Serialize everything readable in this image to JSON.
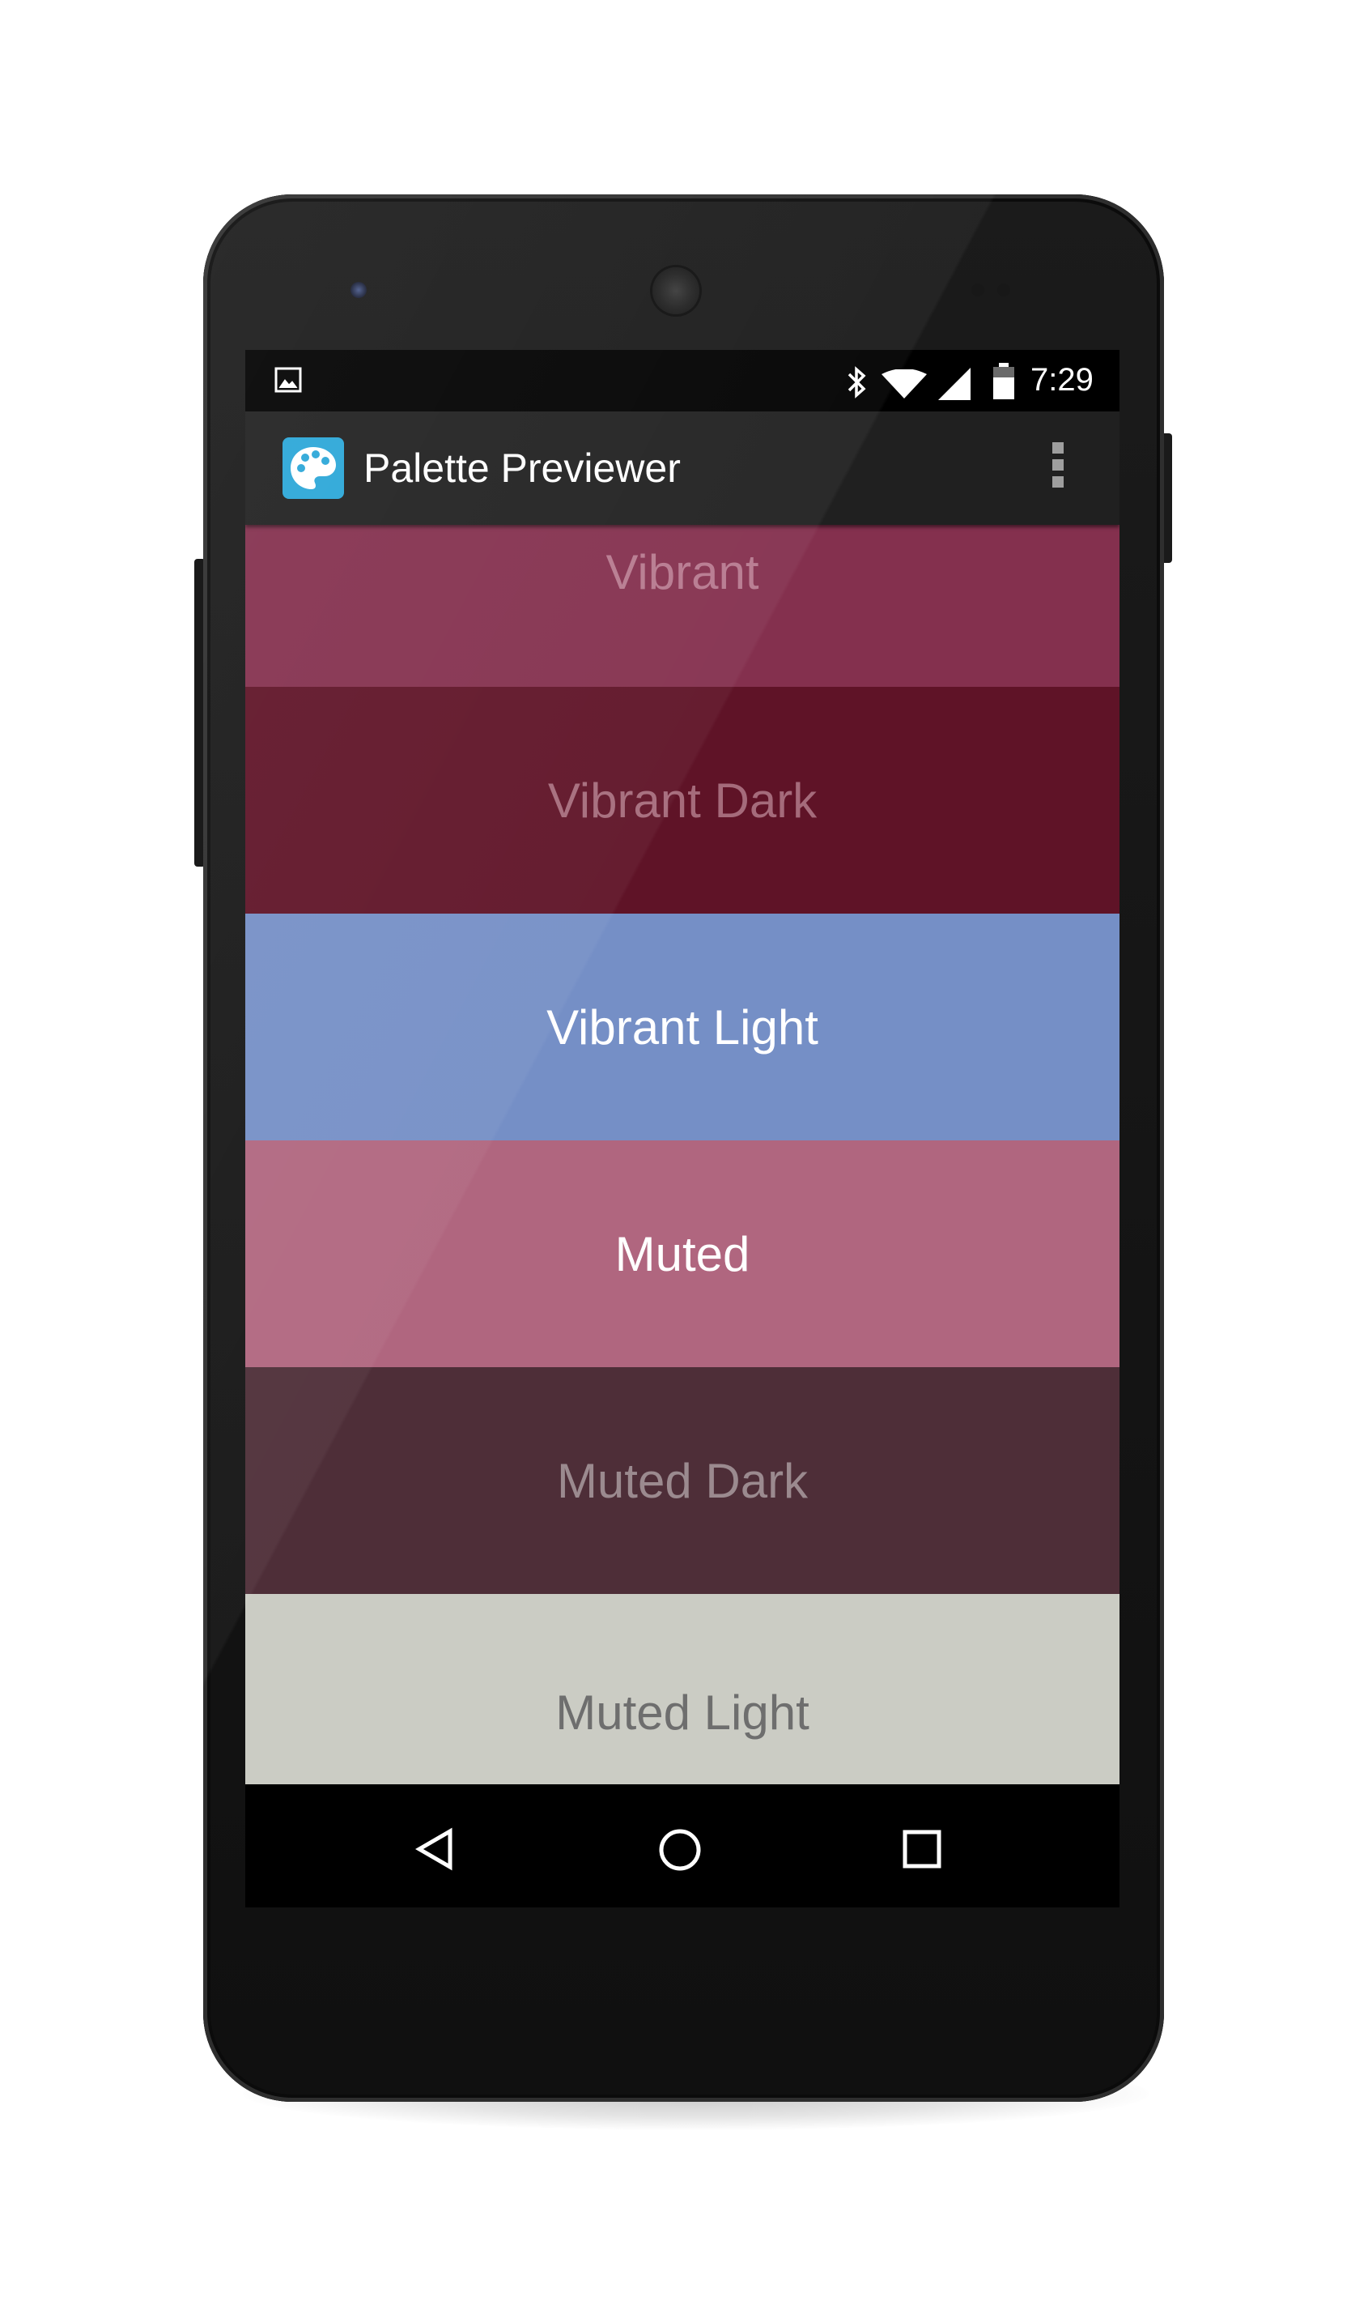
{
  "status_bar": {
    "time": "7:29",
    "icons": [
      "image-notification-icon",
      "bluetooth-icon",
      "wifi-icon",
      "signal-icon",
      "battery-icon"
    ]
  },
  "action_bar": {
    "title": "Palette Previewer",
    "app_icon": "palette-icon",
    "app_icon_color": "#2aa6d8",
    "overflow_icon": "more-vert-icon"
  },
  "swatches": [
    {
      "label": "Vibrant",
      "background": "#84304e",
      "text_color": "#b7798f"
    },
    {
      "label": "Vibrant Dark",
      "background": "#5f1327",
      "text_color": "#a56b7b"
    },
    {
      "label": "Vibrant Light",
      "background": "#758fc6",
      "text_color": "#ffffff"
    },
    {
      "label": "Muted",
      "background": "#b0667f",
      "text_color": "#ffffff"
    },
    {
      "label": "Muted Dark",
      "background": "#4e2e38",
      "text_color": "#9b8a8f"
    },
    {
      "label": "Muted Light",
      "background": "#cbccc4",
      "text_color": "#6e6e6e"
    }
  ],
  "nav_bar": {
    "icons": [
      "back-icon",
      "home-icon",
      "recents-icon"
    ]
  }
}
